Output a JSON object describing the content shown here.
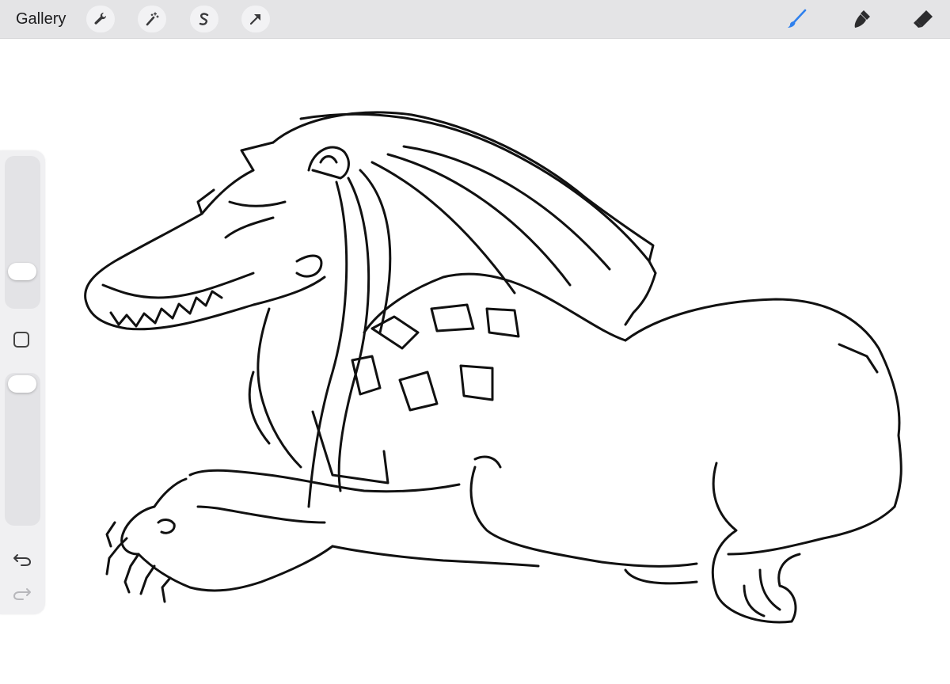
{
  "toolbar": {
    "gallery_label": "Gallery",
    "left_tools": [
      "wrench-icon",
      "magic-wand-icon",
      "selection-icon",
      "transform-arrow-icon"
    ],
    "right_tools": [
      "brush-icon",
      "smudge-icon",
      "eraser-icon"
    ],
    "active_tool": "brush",
    "active_color": "#2f80ed"
  },
  "sidebar": {
    "brush_size_level": 0.75,
    "opacity_level": 0.0,
    "buttons": [
      "modify-button",
      "undo-icon",
      "redo-icon"
    ]
  },
  "canvas": {
    "drawing": "line art"
  }
}
